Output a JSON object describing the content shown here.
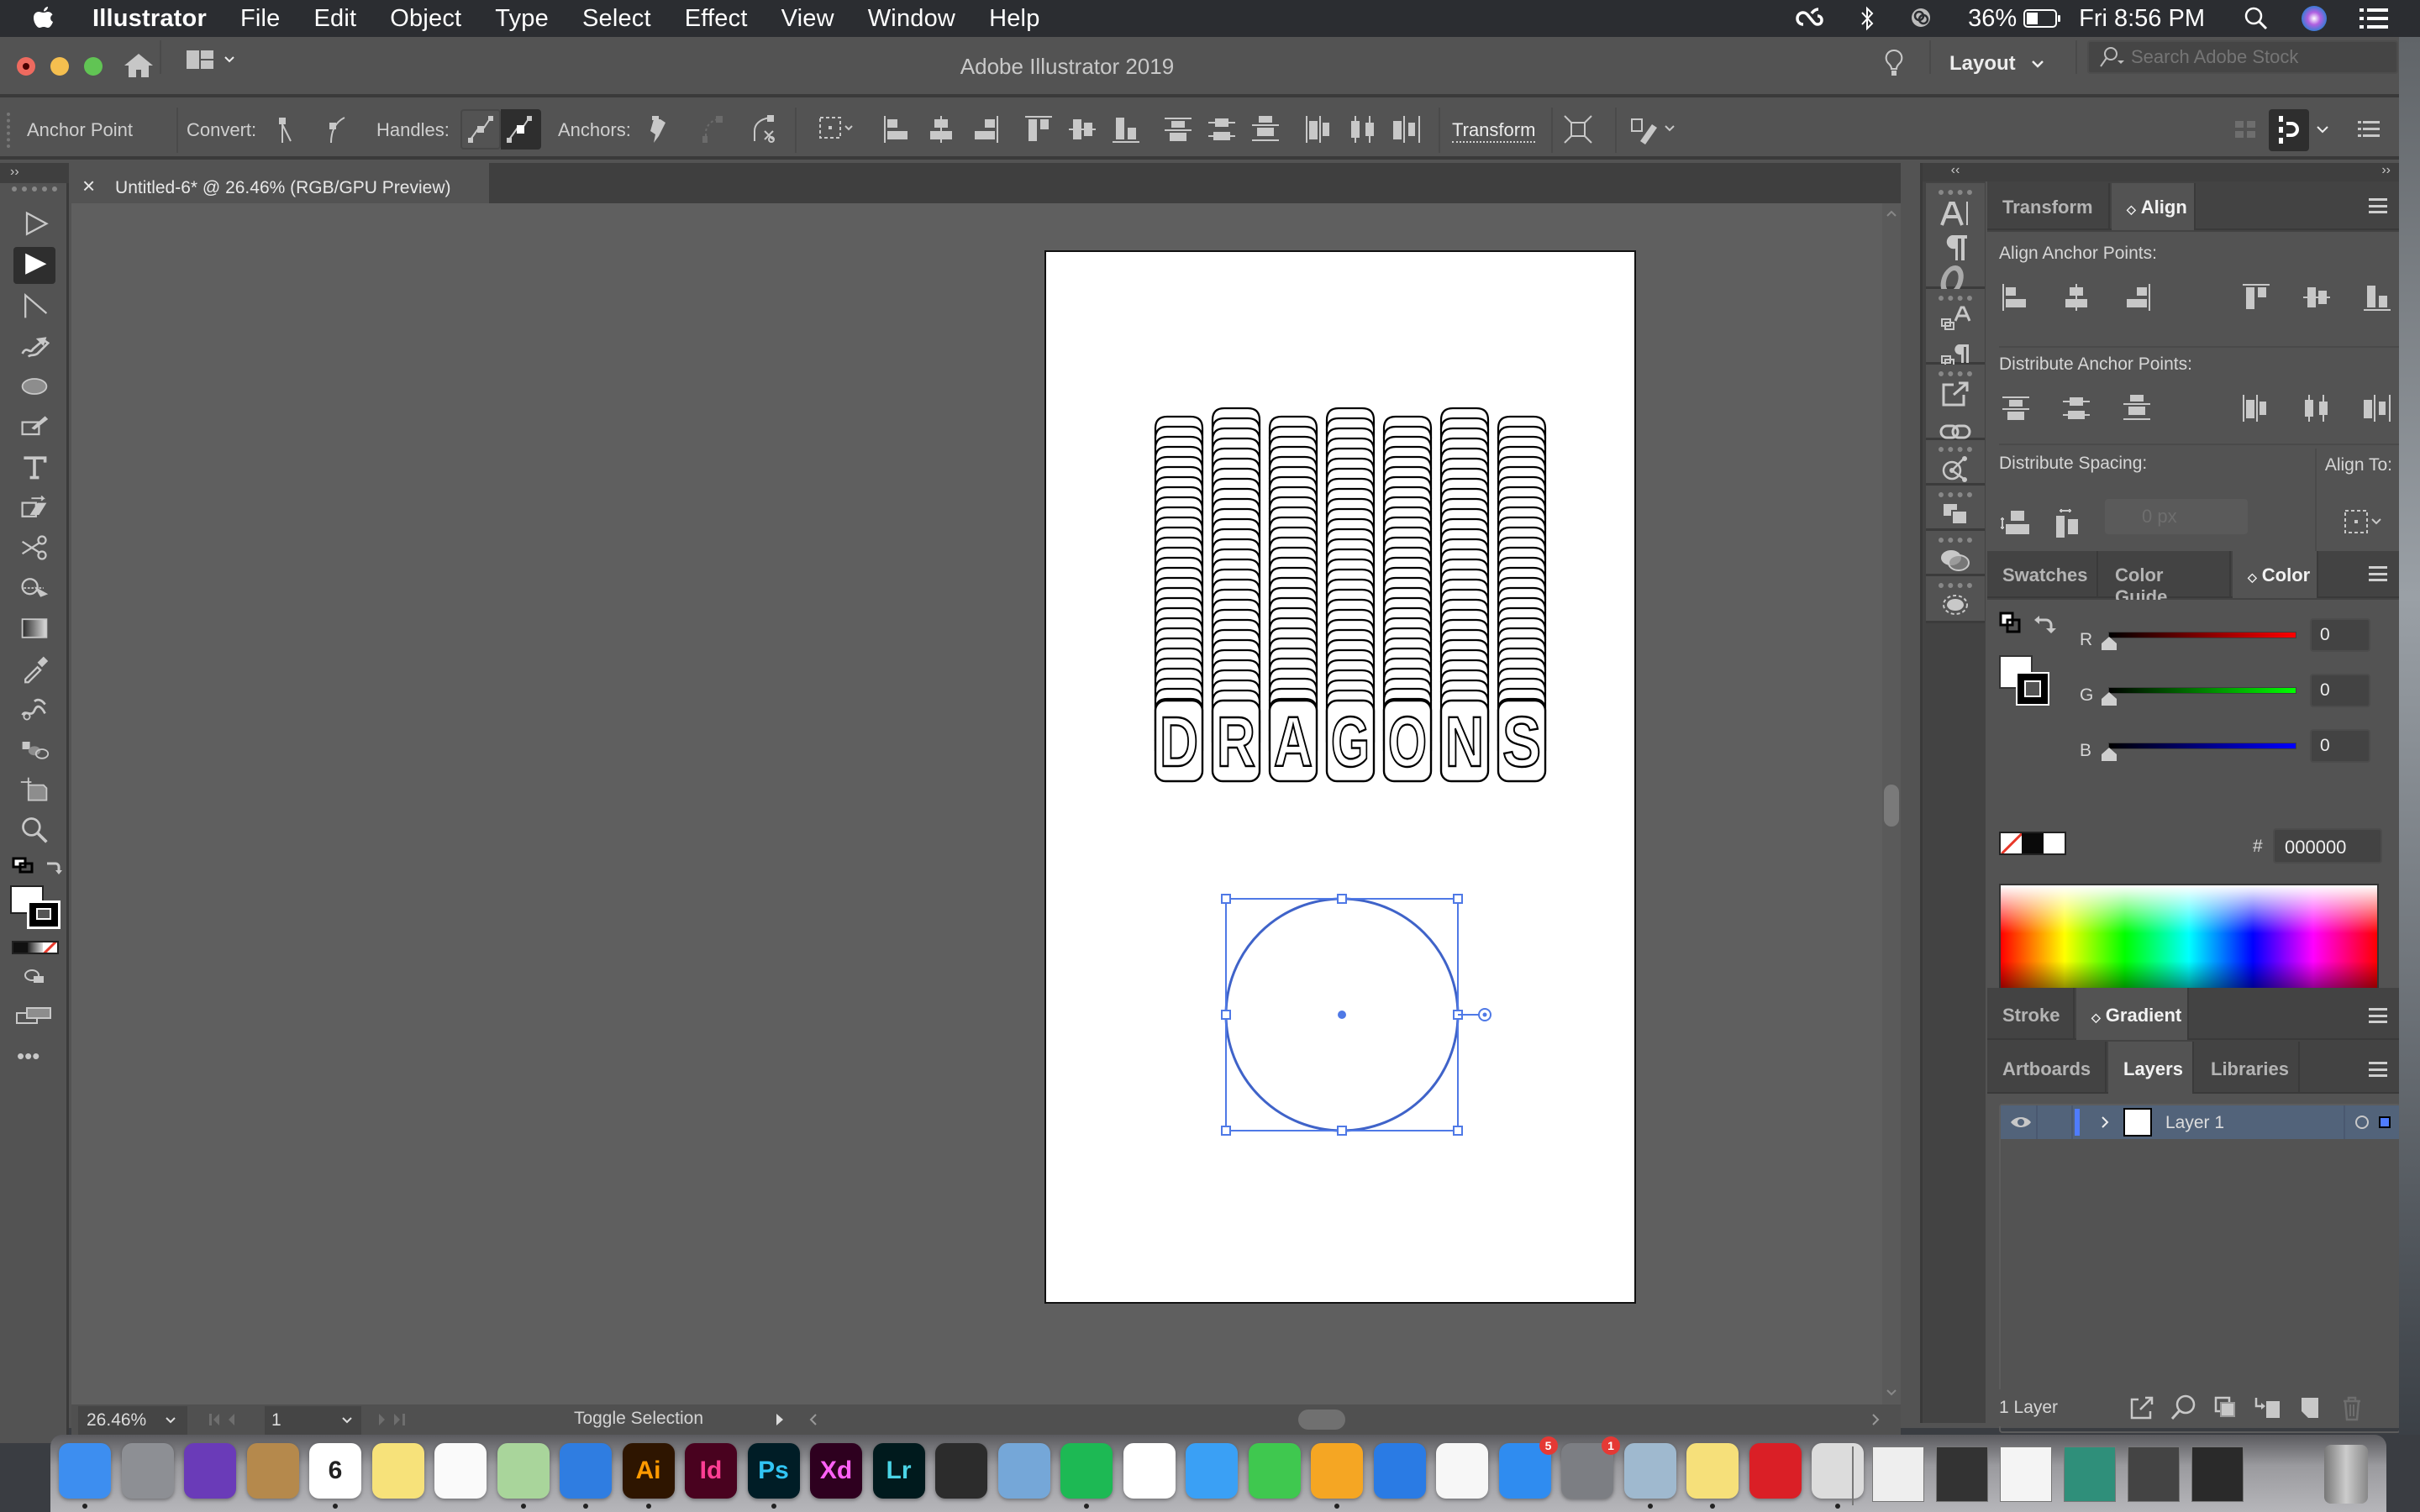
{
  "menubar": {
    "app_name": "Illustrator",
    "menus": [
      "File",
      "Edit",
      "Object",
      "Type",
      "Select",
      "Effect",
      "View",
      "Window",
      "Help"
    ],
    "battery": "36%",
    "clock": "Fri 8:56 PM",
    "status_icons": [
      "creative-cloud-icon",
      "bluetooth-icon",
      "airplay-icon",
      "battery-icon",
      "spotlight-icon",
      "siri-icon",
      "notification-center-icon"
    ]
  },
  "window": {
    "title": "Adobe Illustrator 2019",
    "workspace": "Layout",
    "search_placeholder": "Search Adobe Stock"
  },
  "controlbar": {
    "tool_name": "Anchor Point",
    "convert_label": "Convert:",
    "handles_label": "Handles:",
    "anchors_label": "Anchors:",
    "transform_label": "Transform"
  },
  "document": {
    "tab_title": "Untitled-6* @ 26.46% (RGB/GPU Preview)",
    "close_glyph": "×"
  },
  "statusbar": {
    "zoom": "26.46%",
    "artboard_number": "1",
    "status_text": "Toggle Selection"
  },
  "artwork": {
    "headline": "DRAGONS",
    "selection": "circle"
  },
  "panels": {
    "align_group": {
      "tabs": [
        "Transform",
        "Align"
      ],
      "active_tab": "Align",
      "align_anchor_label": "Align Anchor Points:",
      "distribute_anchor_label": "Distribute Anchor Points:",
      "distribute_spacing_label": "Distribute Spacing:",
      "align_to_label": "Align To:",
      "spacing_value": "0 px"
    },
    "color_group": {
      "tabs": [
        "Swatches",
        "Color Guide",
        "Color"
      ],
      "active_tab": "Color",
      "channels": [
        {
          "label": "R",
          "value": "0",
          "level": 0
        },
        {
          "label": "G",
          "value": "0",
          "level": 0
        },
        {
          "label": "B",
          "value": "0",
          "level": 0
        }
      ],
      "hex_label": "#",
      "hex_value": "000000"
    },
    "stroke_group": {
      "tabs": [
        "Stroke",
        "Gradient"
      ],
      "active_tab": "Gradient"
    },
    "layers_group": {
      "tabs": [
        "Artboards",
        "Layers",
        "Libraries"
      ],
      "active_tab": "Layers",
      "layers": [
        {
          "name": "Layer 1",
          "color": "#4f7cff",
          "visible": true
        }
      ],
      "footer_count": "1 Layer"
    }
  },
  "dock": {
    "apps": [
      {
        "name": "Finder",
        "label": "",
        "bg": "#3d8ef0",
        "fg": "#fff",
        "running": true
      },
      {
        "name": "Launchpad",
        "label": "",
        "bg": "#8d8f94",
        "fg": "#fff",
        "running": false
      },
      {
        "name": "Siri",
        "label": "",
        "bg": "#6a3bb8",
        "fg": "#fff",
        "running": false
      },
      {
        "name": "Contacts",
        "label": "",
        "bg": "#b5894c",
        "fg": "#fff",
        "running": false
      },
      {
        "name": "Calendar",
        "label": "6",
        "bg": "#ffffff",
        "fg": "#222",
        "running": true
      },
      {
        "name": "Notes",
        "label": "",
        "bg": "#f7e27a",
        "fg": "#444",
        "running": false
      },
      {
        "name": "Reminders",
        "label": "",
        "bg": "#fafafa",
        "fg": "#444",
        "running": false
      },
      {
        "name": "Maps",
        "label": "",
        "bg": "#a9d59b",
        "fg": "#444",
        "running": true
      },
      {
        "name": "Safari",
        "label": "",
        "bg": "#2f7de1",
        "fg": "#fff",
        "running": true
      },
      {
        "name": "Illustrator",
        "label": "Ai",
        "bg": "#2e1500",
        "fg": "#ff9a00",
        "running": true
      },
      {
        "name": "InDesign",
        "label": "Id",
        "bg": "#49021f",
        "fg": "#ff3f94",
        "running": false
      },
      {
        "name": "Photoshop",
        "label": "Ps",
        "bg": "#001d26",
        "fg": "#31c5f4",
        "running": true
      },
      {
        "name": "Adobe XD",
        "label": "Xd",
        "bg": "#2e001f",
        "fg": "#ff61f6",
        "running": false
      },
      {
        "name": "Lightroom",
        "label": "Lr",
        "bg": "#001a1d",
        "fg": "#4bd4e6",
        "running": false
      },
      {
        "name": "Figma",
        "label": "",
        "bg": "#2c2c2c",
        "fg": "#f24e1e",
        "running": false
      },
      {
        "name": "Kindle",
        "label": "",
        "bg": "#75a7d8",
        "fg": "#000",
        "running": false
      },
      {
        "name": "Spotify",
        "label": "",
        "bg": "#1db954",
        "fg": "#000",
        "running": true
      },
      {
        "name": "Photos",
        "label": "",
        "bg": "#ffffff",
        "fg": "#444",
        "running": false
      },
      {
        "name": "Messages",
        "label": "",
        "bg": "#3aa0f5",
        "fg": "#fff",
        "running": false
      },
      {
        "name": "FaceTime",
        "label": "",
        "bg": "#3fc84f",
        "fg": "#fff",
        "running": false
      },
      {
        "name": "Pages",
        "label": "",
        "bg": "#f5a623",
        "fg": "#fff",
        "running": true
      },
      {
        "name": "Keynote",
        "label": "",
        "bg": "#2a7be4",
        "fg": "#fff",
        "running": false
      },
      {
        "name": "iTunes",
        "label": "",
        "bg": "#f7f7f7",
        "fg": "#e83a8b",
        "running": false
      },
      {
        "name": "App Store",
        "label": "",
        "bg": "#2f8cf0",
        "fg": "#fff",
        "running": false,
        "badge": "5"
      },
      {
        "name": "System Preferences",
        "label": "",
        "bg": "#7c7e83",
        "fg": "#fff",
        "running": false,
        "badge": "1"
      },
      {
        "name": "Preview",
        "label": "",
        "bg": "#9fb9cf",
        "fg": "#333",
        "running": true
      },
      {
        "name": "Stickies",
        "label": "",
        "bg": "#f6e07a",
        "fg": "#333",
        "running": true
      },
      {
        "name": "Creative Cloud",
        "label": "",
        "bg": "#da1f26",
        "fg": "#fff",
        "running": false
      },
      {
        "name": "Printer",
        "label": "",
        "bg": "#dcdcdc",
        "fg": "#333",
        "running": true
      }
    ],
    "recent": [
      "Document 1",
      "Document 2",
      "Document 3",
      "Document 4",
      "Document 5",
      "Document 6"
    ],
    "trash": "Trash"
  }
}
